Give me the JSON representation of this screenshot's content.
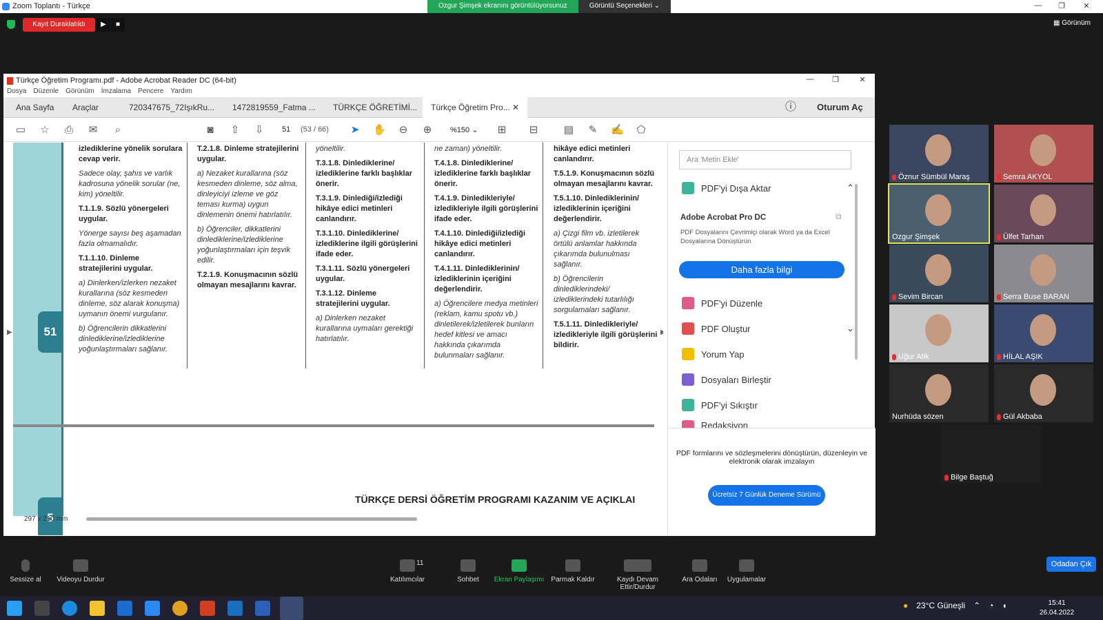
{
  "zoom": {
    "window_title": "Zoom Toplantı - Türkçe",
    "share_notice": "Ozgur Şimşek ekranını görüntülüyorsunuz",
    "view_options": "Görüntü Seçenekleri",
    "recording_label": "Kayıt Duraklatıldı",
    "view_label": "Görünüm"
  },
  "acrobat": {
    "window_title": "Türkçe Öğretim Programı.pdf - Adobe Acrobat Reader DC (64-bit)",
    "menu": [
      "Dosya",
      "Düzenle",
      "Görünüm",
      "İmzalama",
      "Pencere",
      "Yardım"
    ],
    "tabs": [
      "Ana Sayfa",
      "Araçlar",
      "720347675_72IşıkRu...",
      "1472819559_Fatma ...",
      "TÜRKÇE ÖĞRETİMİ...",
      "Türkçe Öğretim Pro..."
    ],
    "signin": "Oturum Aç",
    "page_current": "51",
    "page_info": "(53 / 66)",
    "zoom": "%150",
    "page_dims": "297 x 210 mm",
    "page_tab_number": "51",
    "page_tab_number2": "5",
    "footer_title": "TÜRKÇE DERSİ ÖĞRETİM PROGRAMI KAZANIM VE AÇIKLAI",
    "columns": [
      [
        {
          "style": "b",
          "text": "izlediklerine yönelik sorulara cevap verir."
        },
        {
          "style": "i",
          "text": "Sadece olay, şahıs ve varlık kadrosuna yönelik sorular (ne, kim) yöneltilir."
        },
        {
          "style": "b",
          "text": "T.1.1.9. Sözlü yönergeleri uygular."
        },
        {
          "style": "i",
          "text": "Yönerge sayısı beş aşamadan fazla olmamalıdır."
        },
        {
          "style": "b",
          "text": "T.1.1.10. Dinleme stratejilerini uygular."
        },
        {
          "style": "i",
          "text": "a) Dinlerken/izlerken nezaket kurallarına (söz kesmeden dinleme, söz alarak konuşma) uymanın önemi vurgulanır."
        },
        {
          "style": "i",
          "text": "b) Öğrencilerin dikkatlerini dinlediklerine/izlediklerine yoğunlaştırmaları sağlanır."
        }
      ],
      [
        {
          "style": "b",
          "text": "T.2.1.8. Dinleme stratejilerini uygular."
        },
        {
          "style": "i",
          "text": "a) Nezaket kurallarına (söz kesmeden dinleme, söz alma, dinleyiciyi izleme ve göz teması kurma) uygun dinlemenin önemi hatırlatılır."
        },
        {
          "style": "i",
          "text": "b) Öğrenciler, dikkatlerini dinlediklerine/izlediklerine yoğunlaştırmaları için teşvik edilir."
        },
        {
          "style": "b",
          "text": "T.2.1.9. Konuşmacının sözlü olmayan mesajlarını kavrar."
        }
      ],
      [
        {
          "style": "i",
          "text": "yöneltilir."
        },
        {
          "style": "b",
          "text": "T.3.1.8. Dinlediklerine/ izlediklerine farklı başlıklar önerir."
        },
        {
          "style": "b",
          "text": "T.3.1.9. Dinlediği/izlediği hikâye edici metinleri canlandırır."
        },
        {
          "style": "b",
          "text": "T.3.1.10. Dinlediklerine/ izlediklerine ilgili görüşlerini ifade eder."
        },
        {
          "style": "b",
          "text": "T.3.1.11. Sözlü yönergeleri uygular."
        },
        {
          "style": "b",
          "text": "T.3.1.12. Dinleme stratejilerini uygular."
        },
        {
          "style": "i",
          "text": "a) Dinlerken nezaket kurallarına uymaları gerektiği hatırlatılır."
        }
      ],
      [
        {
          "style": "i",
          "text": "ne zaman) yöneltilir."
        },
        {
          "style": "b",
          "text": "T.4.1.8. Dinlediklerine/ izlediklerine farklı başlıklar önerir."
        },
        {
          "style": "b",
          "text": "T.4.1.9. Dinledikleriyle/ izledikleriyle ilgili görüşlerini ifade eder."
        },
        {
          "style": "b",
          "text": "T.4.1.10. Dinlediği/izlediği hikâye edici metinleri canlandırır."
        },
        {
          "style": "b",
          "text": "T.4.1.11. Dinlediklerinin/ izlediklerinin içeriğini değerlendirir."
        },
        {
          "style": "i",
          "text": "a) Öğrencilere medya metinleri (reklam, kamu spotu vb.) dinletilerek/izletilerek bunların hedef kitlesi ve amacı hakkında çıkarımda bulunmaları sağlanır."
        }
      ],
      [
        {
          "style": "b",
          "text": "hikâye edici metinleri canlandırır."
        },
        {
          "style": "b",
          "text": "T.5.1.9. Konuşmacının sözlü olmayan mesajlarını kavrar."
        },
        {
          "style": "b",
          "text": "T.5.1.10. Dinlediklerinin/ izlediklerinin içeriğini değerlendirir."
        },
        {
          "style": "i",
          "text": "a) Çizgi film vb. izletilerek örtülü anlamlar hakkında çıkarımda bulunulması sağlanır."
        },
        {
          "style": "i",
          "text": "b) Öğrencilerin dinlediklerindeki/ izlediklerindeki tutarlılığı sorgulamaları sağlanır."
        },
        {
          "style": "b",
          "text": "T.5.1.11. Dinledikleriyle/ izledikleriyle ilgili görüşlerini bildirir."
        }
      ]
    ],
    "right_pane": {
      "search_placeholder": "Ara 'Metin Ekle'",
      "export": "PDF'yi Dışa Aktar",
      "pro_title": "Adobe Acrobat Pro DC",
      "pro_desc": "PDF Dosyalarını Çevrimiçi olarak Word ya da Excel Dosyalarına Dönüştürün",
      "more_info": "Daha fazla bilgi",
      "items": [
        "PDF'yi Düzenle",
        "PDF Oluştur",
        "Yorum Yap",
        "Dosyaları Birleştir",
        "PDF'yi Sıkıştır",
        "Redaksiyon"
      ],
      "promo_line1": "PDF formlarını ve sözleşmelerini dönüştürün, düzenleyin ve",
      "promo_line2": "elektronik olarak imzalayın",
      "trial": "Ücretsiz 7 Günlük Deneme Sürümü"
    }
  },
  "participants": [
    {
      "name": "Öznur Sümbül Maraş",
      "muted": true
    },
    {
      "name": "Semra AKYOL",
      "muted": true
    },
    {
      "name": "Ozgur Şimşek",
      "muted": false,
      "active": true
    },
    {
      "name": "Ülfet Tarhan",
      "muted": true
    },
    {
      "name": "Sevim Bircan",
      "muted": true
    },
    {
      "name": "Serra Buse BARAN",
      "muted": true
    },
    {
      "name": "Uğur Atik",
      "muted": true
    },
    {
      "name": "HİLAL AŞIK",
      "muted": true
    },
    {
      "name": "Nurhüda sözen",
      "muted": false
    },
    {
      "name": "Gül Akbaba",
      "muted": true
    },
    {
      "name": "Bilge Baştuğ",
      "muted": true
    }
  ],
  "zoombar": {
    "mute": "Sessize al",
    "video": "Videoyu Durdur",
    "participants": "Katılımcılar",
    "participants_count": "11",
    "chat": "Sohbet",
    "share": "Ekran Paylaşımı",
    "raise": "Parmak Kaldır",
    "record": "Kaydı Devam Ettir/Durdur",
    "breakout": "Ara Odaları",
    "apps": "Uygulamalar",
    "leave": "Odadan Çık"
  },
  "taskbar": {
    "weather": "23°C Güneşli",
    "time": "15:41",
    "date": "26.04.2022"
  }
}
